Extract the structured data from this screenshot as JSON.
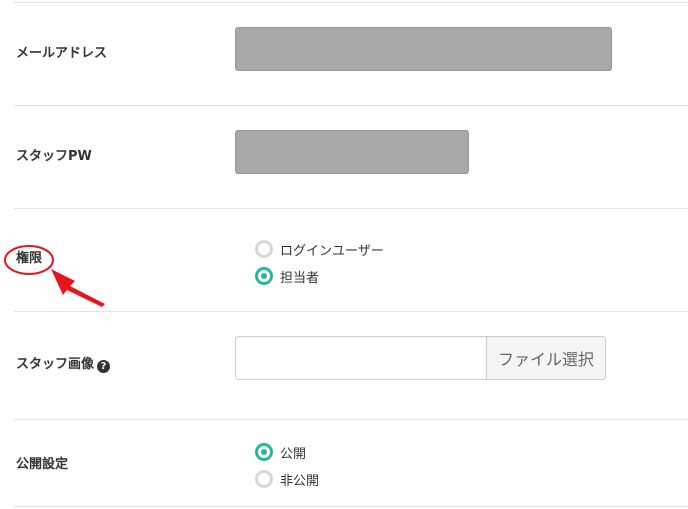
{
  "form": {
    "email": {
      "label": "メールアドレス",
      "value": ""
    },
    "password": {
      "label": "スタッフPW",
      "value": ""
    },
    "role": {
      "label": "権限",
      "options": [
        {
          "label": "ログインユーザー",
          "selected": false
        },
        {
          "label": "担当者",
          "selected": true
        }
      ]
    },
    "image": {
      "label": "スタッフ画像",
      "help_icon": "question-circle-icon",
      "file_path": "",
      "button_label": "ファイル選択"
    },
    "visibility": {
      "label": "公開設定",
      "options": [
        {
          "label": "公開",
          "selected": true
        },
        {
          "label": "非公開",
          "selected": false
        }
      ]
    }
  },
  "colors": {
    "accent": "#26b5a0",
    "masked_field": "#a9a9a9",
    "annotation": "#e8141b"
  }
}
